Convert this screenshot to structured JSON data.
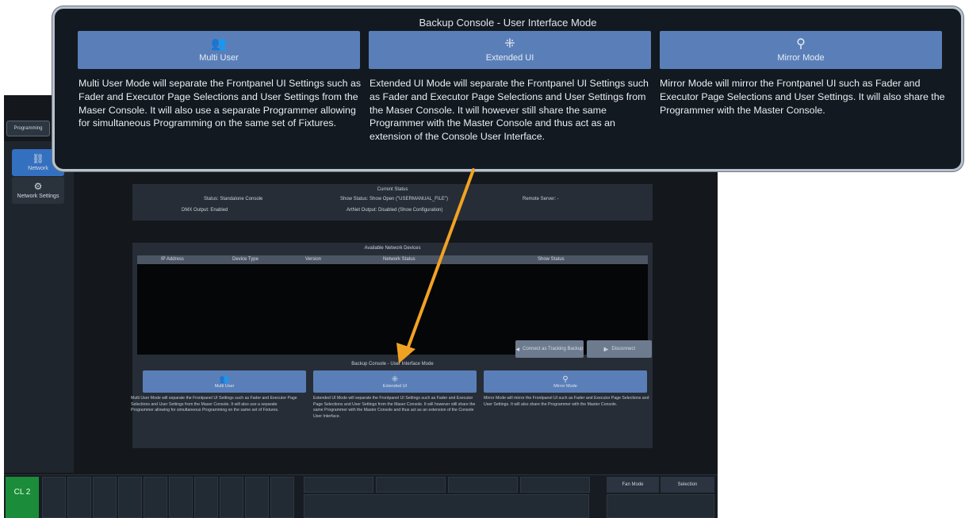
{
  "sidebar": {
    "programming_tab": "Programming",
    "items": [
      {
        "label": "Network",
        "icon": "network-icon"
      },
      {
        "label": "Network Settings",
        "icon": "settings-icon"
      }
    ]
  },
  "status": {
    "title": "Current Status",
    "status": "Status: Standalone Console",
    "dmx": "DMX Output: Enabled",
    "show_status": "Show Status: Show Open (\"USERMANUAL_FILE\")",
    "artnet": "ArtNet Output: Disabled (Show Configuration)",
    "remote": "Remote Server: -"
  },
  "devices": {
    "title": "Available Network Devices",
    "columns": [
      "IP Address",
      "Device Type",
      "Version",
      "Network Status",
      "Show Status"
    ],
    "connect_label": "Connect as Tracking Backup",
    "disconnect_label": "Disconnect"
  },
  "mode": {
    "title": "Backup Console - User Interface Mode",
    "cards": [
      {
        "label": "Multi User",
        "icon": "users-icon",
        "desc": "Multi User Mode will separate the Frontpanel UI Settings such as Fader and Executor Page Selections and User Settings from the Maser Console. It will also use a separate Programmer allowing for simultaneous Programming on the same set of Fixtures."
      },
      {
        "label": "Extended UI",
        "icon": "extend-icon",
        "desc": "Extended UI Mode will separate the Frontpanel UI Settings such as Fader and Executor Page Selections and User Settings from the Maser Console. It will however still share the same Programmer with the Master Console and thus act as an extension of the Console User Interface."
      },
      {
        "label": "Mirror Mode",
        "icon": "mirror-icon",
        "desc": "Mirror Mode will mirror the Frontpanel UI such as Fader and Executor Page Selections and User Settings. It will also share the Programmer with the Master Console."
      }
    ]
  },
  "bottom": {
    "cue_list": "CL 2",
    "fan_mode": "Fan Mode",
    "selection": "Selection"
  },
  "colors": {
    "accent": "#5a7fb8",
    "active": "#3470c0",
    "arrow": "#f2a223",
    "cue_green": "#1b8c3a"
  }
}
